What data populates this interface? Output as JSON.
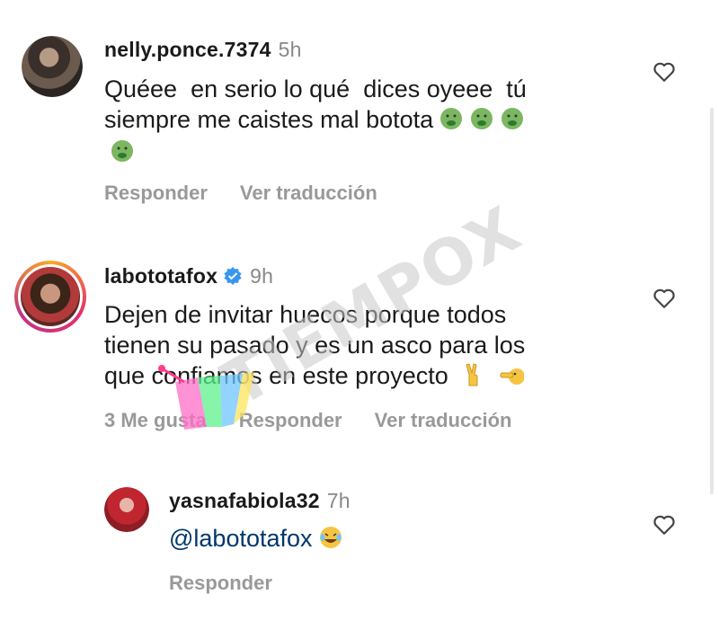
{
  "comments": [
    {
      "username": "nelly.ponce.7374",
      "time": "5h",
      "text": "Quéee  en serio lo qué  dices oyeee  tú\nsiempre me caistes mal botota",
      "text_line2_suffix_emojis": [
        "nauseated-face-emoji",
        "nauseated-face-emoji",
        "nauseated-face-emoji",
        "nauseated-face-emoji"
      ],
      "actions": {
        "reply": "Responder",
        "translate": "Ver traducción"
      }
    },
    {
      "username": "labototafox",
      "verified": true,
      "time": "9h",
      "text": "Dejen de invitar huecos porque todos\ntienen su pasado y es un asco para los\nque confiamos en este proyecto",
      "emojis": [
        "victory-hand-emoji",
        "finger-pointing-emoji"
      ],
      "actions": {
        "likes": "3 Me gusta",
        "reply": "Responder",
        "translate": "Ver traducción"
      }
    },
    {
      "username": "yasnafabiola32",
      "time": "7h",
      "text": "@labototafox",
      "emojis": [
        "laughing-tears-emoji"
      ],
      "actions": {
        "reply": "Responder"
      }
    }
  ],
  "watermark": "TIEMPOX",
  "colors": {
    "accent_link": "#00376b",
    "muted": "#999999",
    "verified": "#3797f0"
  }
}
